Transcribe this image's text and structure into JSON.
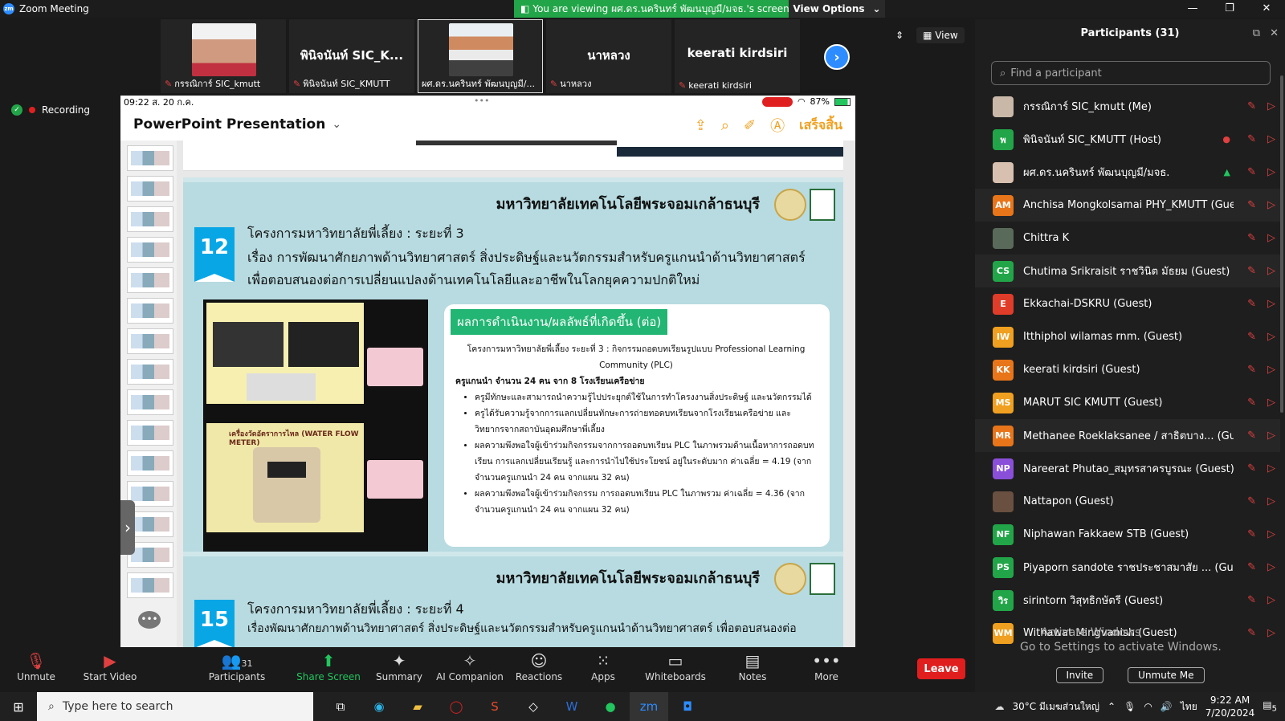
{
  "window": {
    "title": "Zoom Meeting",
    "banner": "You are viewing ผศ.ดร.นครินทร์ พัฒนบุญมี/มจธ.'s screen",
    "view_options": "View Options"
  },
  "recording": "Recording",
  "video_tiles": [
    {
      "big": "",
      "name": "กรรณิการ์ SIC_kmutt",
      "photo_color": "#d8d0c8"
    },
    {
      "big": "พินิจนันท์ SIC_K...",
      "name": "พินิจนันท์ SIC_KMUTT",
      "photo_color": ""
    },
    {
      "big": "",
      "name": "ผศ.ดร.นครินทร์ พัฒนบุญมี/...",
      "photo_color": "#c89880"
    },
    {
      "big": "นาหลวง",
      "name": "นาหลวง",
      "photo_color": ""
    },
    {
      "big": "keerati kirdsiri",
      "name": "keerati kirdsiri",
      "photo_color": ""
    }
  ],
  "view_label": "View",
  "ipad": {
    "time": "09:22  ส. 20 ก.ค.",
    "battery": "87%",
    "app_title": "PowerPoint Presentation",
    "done_label": "เสร็จสิ้น"
  },
  "slides": {
    "uni": "มหาวิทยาลัยเทคโนโลยีพระจอมเกล้าธนบุรี",
    "s12": {
      "num": "12",
      "title": "โครงการมหาวิทยาลัยพี่เลี้ยง : ระยะที่ 3",
      "subtitle1": "เรื่อง การพัฒนาศักยภาพด้านวิทยาศาสตร์ สิ่งประดิษฐ์และนวัตกรรมสำหรับครูแกนนำด้านวิทยาศาสตร์",
      "subtitle2": "เพื่อตอบสนองต่อการเปลี่ยนแปลงด้านเทคโนโลยีและอาชีพในโลกยุคความปกติใหม่",
      "photo_caption": "เครื่องวัดอัตราการไหล (WATER FLOW METER)",
      "panel_title": "ผลการดำเนินงาน/ผลลัพธ์ที่เกิดขึ้น (ต่อ)",
      "panel_intro": "โครงการมหาวิทยาลัยพี่เลี้ยง ระยะที่ 3 : กิจกรรมถอดบทเรียนรูปแบบ Professional Learning Community (PLC)",
      "panel_count": "ครูแกนนำ จำนวน 24 คน จาก 8 โรงเรียนเครือข่าย",
      "bullets": [
        "ครูมีทักษะและสามารถนำความรู้ไปประยุกต์ใช้ในการทำโครงงานสิ่งประดิษฐ์  และนวัตกรรมได้",
        "ครูได้รับความรู้จากการแลกเปลี่ยนทักษะการถ่ายทอดบทเรียนจากโรงเรียนเครือข่าย และวิทยากรจากสถาบันอุดมศึกษาพี่เลี้ยง",
        "ผลความพึงพอใจผู้เข้าร่วมกิจกรรมจากการถอดบทเรียน PLC ในภาพรวมด้านเนื้อหาการถอดบทเรียน การแลกเปลี่ยนเรียนรู้ และการนำไปใช้ประโยชน์ อยู่ในระดับมาก ค่าเฉลี่ย = 4.19 (จากจำนวนครูแกนนำ 24 คน จากแผน 32 คน)",
        "ผลความพึงพอใจผู้เข้าร่วมกิจกรรม การถอดบทเรียน PLC ในภาพรวม ค่าเฉลี่ย = 4.36 (จากจำนวนครูแกนนำ 24 คน จากแผน 32 คน)"
      ]
    },
    "s15": {
      "num": "15",
      "title": "โครงการมหาวิทยาลัยพี่เลี้ยง : ระยะที่ 4",
      "subtitle1": "เรื่องพัฒนาศักยภาพด้านวิทยาศาสตร์ สิ่งประดิษฐ์และนวัตกรรมสำหรับครูแกนนำด้านวิทยาศาสตร์ เพื่อตอบสนองต่อ"
    }
  },
  "participants": {
    "header": "Participants (31)",
    "search_placeholder": "Find a participant",
    "list": [
      {
        "name": "กรรณิการ์  SIC_kmutt (Me)",
        "initials": "",
        "color": "#c9b8a8",
        "extra": ""
      },
      {
        "name": "พินิจนันท์ SIC_KMUTT (Host)",
        "initials": "พ",
        "color": "#22a548",
        "extra": "●"
      },
      {
        "name": "ผศ.ดร.นครินทร์ พัฒนบุญมี/มจธ.",
        "initials": "",
        "color": "#d8c0b0",
        "extra": "▲"
      },
      {
        "name": "Anchisa Mongkolsamai PHY_KMUTT (Guest)",
        "initials": "AM",
        "color": "#e8751a",
        "extra": ""
      },
      {
        "name": "Chittra K",
        "initials": "",
        "color": "#5a6a5a",
        "extra": ""
      },
      {
        "name": "Chutima Srikraisit ราชวินิต มัธยม (Guest)",
        "initials": "CS",
        "color": "#22a548",
        "extra": ""
      },
      {
        "name": "Ekkachai-DSKRU (Guest)",
        "initials": "E",
        "color": "#e03c2a",
        "extra": ""
      },
      {
        "name": "Itthiphol wilamas rnm. (Guest)",
        "initials": "IW",
        "color": "#f0a020",
        "extra": ""
      },
      {
        "name": "keerati kirdsiri (Guest)",
        "initials": "KK",
        "color": "#e8751a",
        "extra": ""
      },
      {
        "name": "MARUT SIC KMUTT (Guest)",
        "initials": "MS",
        "color": "#f0a020",
        "extra": ""
      },
      {
        "name": "Methanee Roeklaksanee / สาธิตบาง... (Guest)",
        "initials": "MR",
        "color": "#e8751a",
        "extra": ""
      },
      {
        "name": "Nareerat Phutao_สมุทรสาครบูรณะ (Guest)",
        "initials": "NP",
        "color": "#8a4fd8",
        "extra": ""
      },
      {
        "name": "Nattapon (Guest)",
        "initials": "",
        "color": "#6a5040",
        "extra": ""
      },
      {
        "name": "Niphawan Fakkaew STB (Guest)",
        "initials": "NF",
        "color": "#22a548",
        "extra": ""
      },
      {
        "name": "Piyaporn sandote  ราชประชาสมาสัย ... (Guest)",
        "initials": "PS",
        "color": "#22a548",
        "extra": ""
      },
      {
        "name": "sirintorn วิสุทธิกษัตรี (Guest)",
        "initials": "วิร",
        "color": "#22a548",
        "extra": ""
      },
      {
        "name": "Withawat Mingvanish (Guest)",
        "initials": "WM",
        "color": "#f0a020",
        "extra": ""
      }
    ],
    "invite": "Invite",
    "unmute_me": "Unmute Me"
  },
  "activate": {
    "line1": "Activate Windows",
    "line2": "Go to Settings to activate Windows."
  },
  "toolbar": {
    "unmute": "Unmute",
    "start_video": "Start Video",
    "participants": "Participants",
    "participants_count": "31",
    "share": "Share Screen",
    "summary": "Summary",
    "ai": "AI Companion",
    "reactions": "Reactions",
    "apps": "Apps",
    "whiteboards": "Whiteboards",
    "notes": "Notes",
    "more": "More",
    "leave": "Leave"
  },
  "taskbar": {
    "search": "Type here to search",
    "weather": "30°C  มีเมฆส่วนใหญ่",
    "lang": "ไทย",
    "time": "9:22 AM",
    "date": "7/20/2024",
    "notif": "5"
  }
}
